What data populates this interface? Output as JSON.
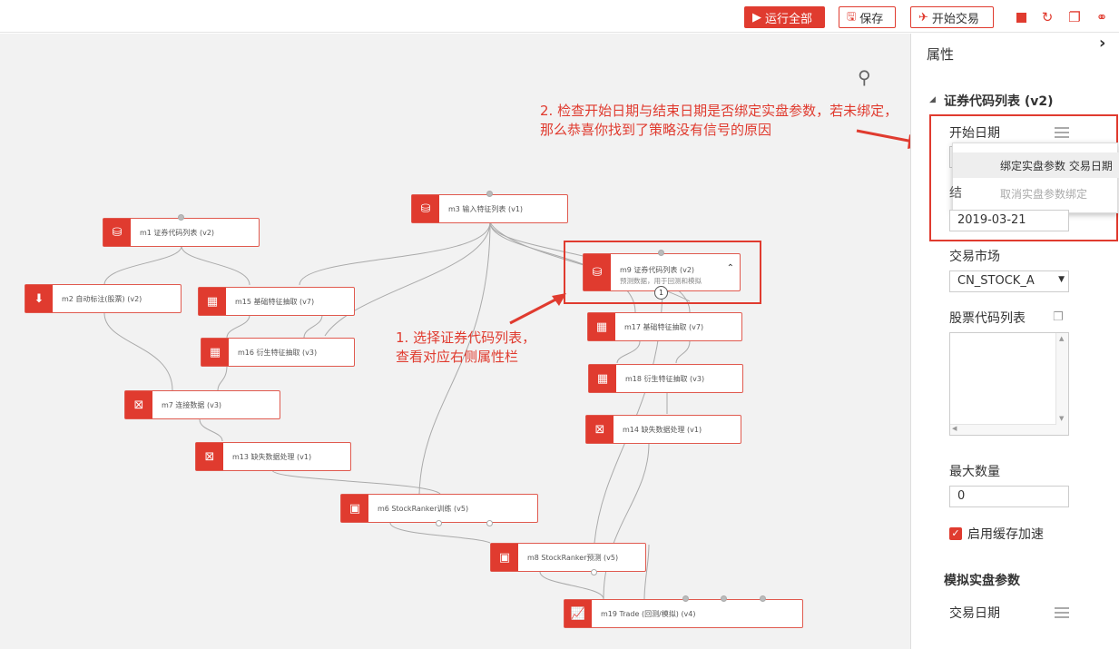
{
  "toolbar": {
    "run_all": "运行全部",
    "save": "保存",
    "start_trade": "开始交易",
    "run_icon": "play-icon",
    "save_icon": "save-icon",
    "trade_icon": "rocket-icon",
    "stop_icon": "stop-icon",
    "refresh_icon": "refresh-icon",
    "copy_icon": "copy-icon",
    "link_icon": "link-icon"
  },
  "canvas": {
    "search_icon": "search-icon",
    "nodes": [
      {
        "id": "m1",
        "label": "m1 证券代码列表 (v2)"
      },
      {
        "id": "m3",
        "label": "m3 输入特征列表 (v1)"
      },
      {
        "id": "m9",
        "label": "m9 证券代码列表 (v2)",
        "sub": "预测数据，用于回测和模拟",
        "badge": "1"
      },
      {
        "id": "m2",
        "label": "m2 自动标注(股票) (v2)"
      },
      {
        "id": "m15",
        "label": "m15 基础特征抽取 (v7)"
      },
      {
        "id": "m16",
        "label": "m16 衍生特征抽取 (v3)"
      },
      {
        "id": "m17",
        "label": "m17 基础特征抽取 (v7)"
      },
      {
        "id": "m18",
        "label": "m18 衍生特征抽取 (v3)"
      },
      {
        "id": "m7",
        "label": "m7 连接数据 (v3)"
      },
      {
        "id": "m14",
        "label": "m14 缺失数据处理 (v1)"
      },
      {
        "id": "m13",
        "label": "m13 缺失数据处理 (v1)"
      },
      {
        "id": "m6",
        "label": "m6 StockRanker训练 (v5)"
      },
      {
        "id": "m8",
        "label": "m8 StockRanker预测 (v5)"
      },
      {
        "id": "m19",
        "label": "m19 Trade (回测/模拟) (v4)"
      }
    ],
    "annotation1": [
      "1. 选择证券代码列表，",
      "查看对应右侧属性栏"
    ],
    "annotation2": [
      "2. 检查开始日期与结束日期是否绑定实盘参数，若未绑定，",
      "那么恭喜你找到了策略没有信号的原因"
    ]
  },
  "panel": {
    "title": "属性",
    "collapse_icon": "chevron-right-icon",
    "section": "证券代码列表 (v2)",
    "start_date_label": "开始日期",
    "context_menu": [
      "绑定实盘参数 交易日期",
      "取消实盘参数绑定"
    ],
    "end_date_value": "2019-03-21",
    "market_label": "交易市场",
    "market_value": "CN_STOCK_A",
    "codes_label": "股票代码列表",
    "max_count_label": "最大数量",
    "max_count_value": "0",
    "cache_label": "启用缓存加速",
    "cache_checked": true,
    "sim_section": "模拟实盘参数",
    "trade_date_label": "交易日期"
  },
  "colors": {
    "accent": "#e03b2f",
    "canvas_bg": "#f2f2f2"
  }
}
